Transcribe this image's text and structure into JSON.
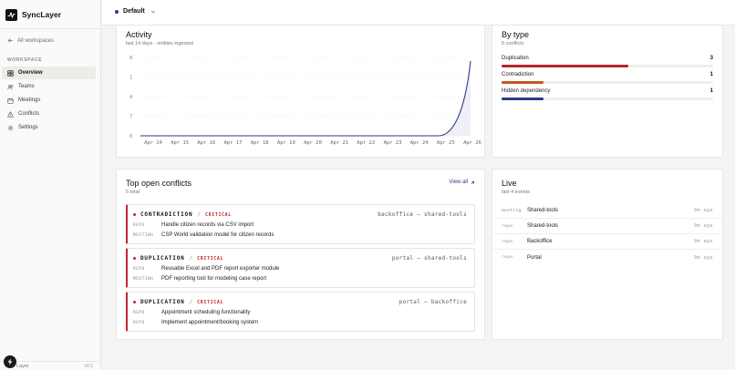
{
  "brand": {
    "name": "SyncLayer"
  },
  "sidebar": {
    "back_label": "All workspaces",
    "section_label": "WORKSPACE",
    "items": [
      {
        "label": "Overview",
        "icon": "grid-icon",
        "active": true
      },
      {
        "label": "Teams",
        "icon": "users-icon",
        "active": false
      },
      {
        "label": "Meetings",
        "icon": "calendar-icon",
        "active": false
      },
      {
        "label": "Conflicts",
        "icon": "warning-icon",
        "active": false
      },
      {
        "label": "Settings",
        "icon": "gear-icon",
        "active": false
      }
    ],
    "footer_left": "Layer",
    "footer_right": "v0.1"
  },
  "topbar": {
    "workspace": "Default"
  },
  "activity": {
    "title": "Activity",
    "subtitle": "last 14 days · entities ingested",
    "chart_data": {
      "type": "area",
      "x": [
        "Apr 14",
        "Apr 15",
        "Apr 16",
        "Apr 17",
        "Apr 18",
        "Apr 19",
        "Apr 20",
        "Apr 21",
        "Apr 22",
        "Apr 23",
        "Apr 24",
        "Apr 25",
        "Apr 26"
      ],
      "y": [
        0,
        0,
        0,
        0,
        0,
        0,
        0,
        0,
        0,
        0,
        0,
        0,
        8
      ],
      "y_tick_labels": [
        "8",
        "1",
        "4",
        "7",
        "0"
      ],
      "ylim": [
        0,
        8
      ],
      "grid": true,
      "color": "#2b3a8c"
    }
  },
  "by_type": {
    "title": "By type",
    "subtitle": "5 conflicts",
    "rows": [
      {
        "label": "Duplication",
        "count": "3",
        "value": 3,
        "max": 3,
        "color": "#b8242b"
      },
      {
        "label": "Contradiction",
        "count": "1",
        "value": 1,
        "max": 3,
        "color": "#c2571a"
      },
      {
        "label": "Hidden dependency",
        "count": "1",
        "value": 1,
        "max": 3,
        "color": "#2b3a8c"
      }
    ]
  },
  "top_conflicts": {
    "title": "Top open conflicts",
    "subtitle": "5 total",
    "view_all": "View all",
    "items": [
      {
        "type": "CONTRADICTION",
        "severity": "CRITICAL",
        "route": "backoffice — shared-tools",
        "lines": [
          {
            "kind": "REPO",
            "text": "Handle citizen records via CSV import"
          },
          {
            "kind": "MEETING",
            "text": "CSP World validation model for citizen records"
          }
        ]
      },
      {
        "type": "DUPLICATION",
        "severity": "CRITICAL",
        "route": "portal — shared-tools",
        "lines": [
          {
            "kind": "REPO",
            "text": "Reusable Excel and PDF report exporter module"
          },
          {
            "kind": "MEETING",
            "text": "PDF reporting tool for modeling case report"
          }
        ]
      },
      {
        "type": "DUPLICATION",
        "severity": "CRITICAL",
        "route": "portal — backoffice",
        "lines": [
          {
            "kind": "REPO",
            "text": "Appointment scheduling functionality"
          },
          {
            "kind": "REPO",
            "text": "Implement appointment/booking system"
          }
        ]
      }
    ]
  },
  "live": {
    "title": "Live",
    "subtitle": "last 4 events",
    "events": [
      {
        "kind": "meeting",
        "name": "Shared-tools",
        "time": "9m ago"
      },
      {
        "kind": "repo",
        "name": "Shared-tools",
        "time": "9m ago"
      },
      {
        "kind": "repo",
        "name": "Backoffice",
        "time": "9m ago"
      },
      {
        "kind": "repo",
        "name": "Portal",
        "time": "9m ago"
      }
    ]
  }
}
